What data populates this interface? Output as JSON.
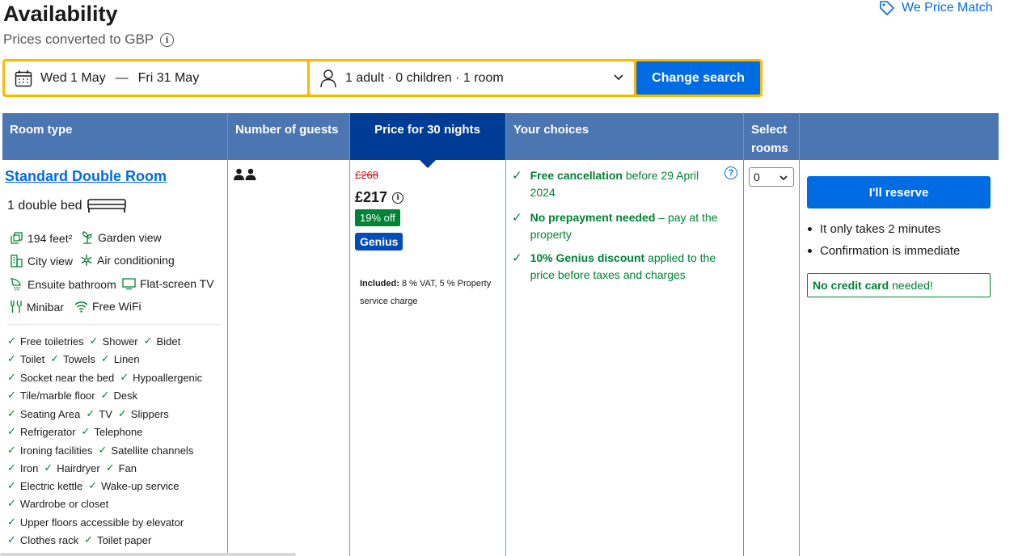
{
  "header": {
    "title": "Availability",
    "subtitle": "Prices converted to GBP",
    "price_match": "We Price Match"
  },
  "search": {
    "check_in": "Wed 1 May",
    "separator": "—",
    "check_out": "Fri 31 May",
    "occupancy": "1 adult · 0 children · 1 room",
    "button": "Change search"
  },
  "table": {
    "headers": {
      "room_type": "Room type",
      "guests": "Number of guests",
      "price": "Price for 30 nights",
      "choices": "Your choices",
      "select_rooms": "Select rooms"
    }
  },
  "room": {
    "name": "Standard Double Room",
    "bed": "1 double bed",
    "features": [
      {
        "label": "194 feet²",
        "icon": "size-icon"
      },
      {
        "label": "Garden view",
        "icon": "garden-icon"
      },
      {
        "label": "City view",
        "icon": "city-icon"
      },
      {
        "label": "Air conditioning",
        "icon": "snowflake-icon"
      },
      {
        "label": "Ensuite bathroom",
        "icon": "shower-icon"
      },
      {
        "label": "Flat-screen TV",
        "icon": "tv-icon"
      },
      {
        "label": "Minibar",
        "icon": "minibar-icon"
      },
      {
        "label": "Free WiFi",
        "icon": "wifi-icon"
      }
    ],
    "amenity_rows": [
      [
        "Free toiletries",
        "Shower",
        "Bidet"
      ],
      [
        "Toilet",
        "Towels",
        "Linen"
      ],
      [
        "Socket near the bed",
        "Hypoallergenic"
      ],
      [
        "Tile/marble floor",
        "Desk"
      ],
      [
        "Seating Area",
        "TV",
        "Slippers"
      ],
      [
        "Refrigerator",
        "Telephone"
      ],
      [
        "Ironing facilities",
        "Satellite channels"
      ],
      [
        "Iron",
        "Hairdryer",
        "Fan"
      ],
      [
        "Electric kettle",
        "Wake-up service"
      ],
      [
        "Wardrobe or closet"
      ],
      [
        "Upper floors accessible by elevator"
      ],
      [
        "Clothes rack",
        "Toilet paper"
      ]
    ],
    "guests_count": 2
  },
  "price": {
    "old": "£268",
    "new": "£217",
    "discount": "19% off",
    "genius": "Genius",
    "included_label": "Included:",
    "included_text": "8 % VAT, 5 % Property service charge"
  },
  "choices": [
    {
      "bold": "Free cancellation",
      "rest": "before 29 April 2024"
    },
    {
      "bold": "No prepayment needed",
      "rest": "– pay at the property"
    },
    {
      "bold": "10% Genius discount",
      "rest": "applied to the price before taxes and charges"
    }
  ],
  "select": {
    "value": "0"
  },
  "reserve": {
    "button": "I'll reserve",
    "bullets": [
      "It only takes 2 minutes",
      "Confirmation is immediate"
    ],
    "no_credit_bold": "No credit card",
    "no_credit_rest": "needed!"
  },
  "colors": {
    "primary_blue": "#006ce4",
    "header_blue": "#4c76b2",
    "active_header": "#003b95",
    "green": "#008234",
    "yellow": "#ffb700",
    "red": "#d4111e"
  }
}
